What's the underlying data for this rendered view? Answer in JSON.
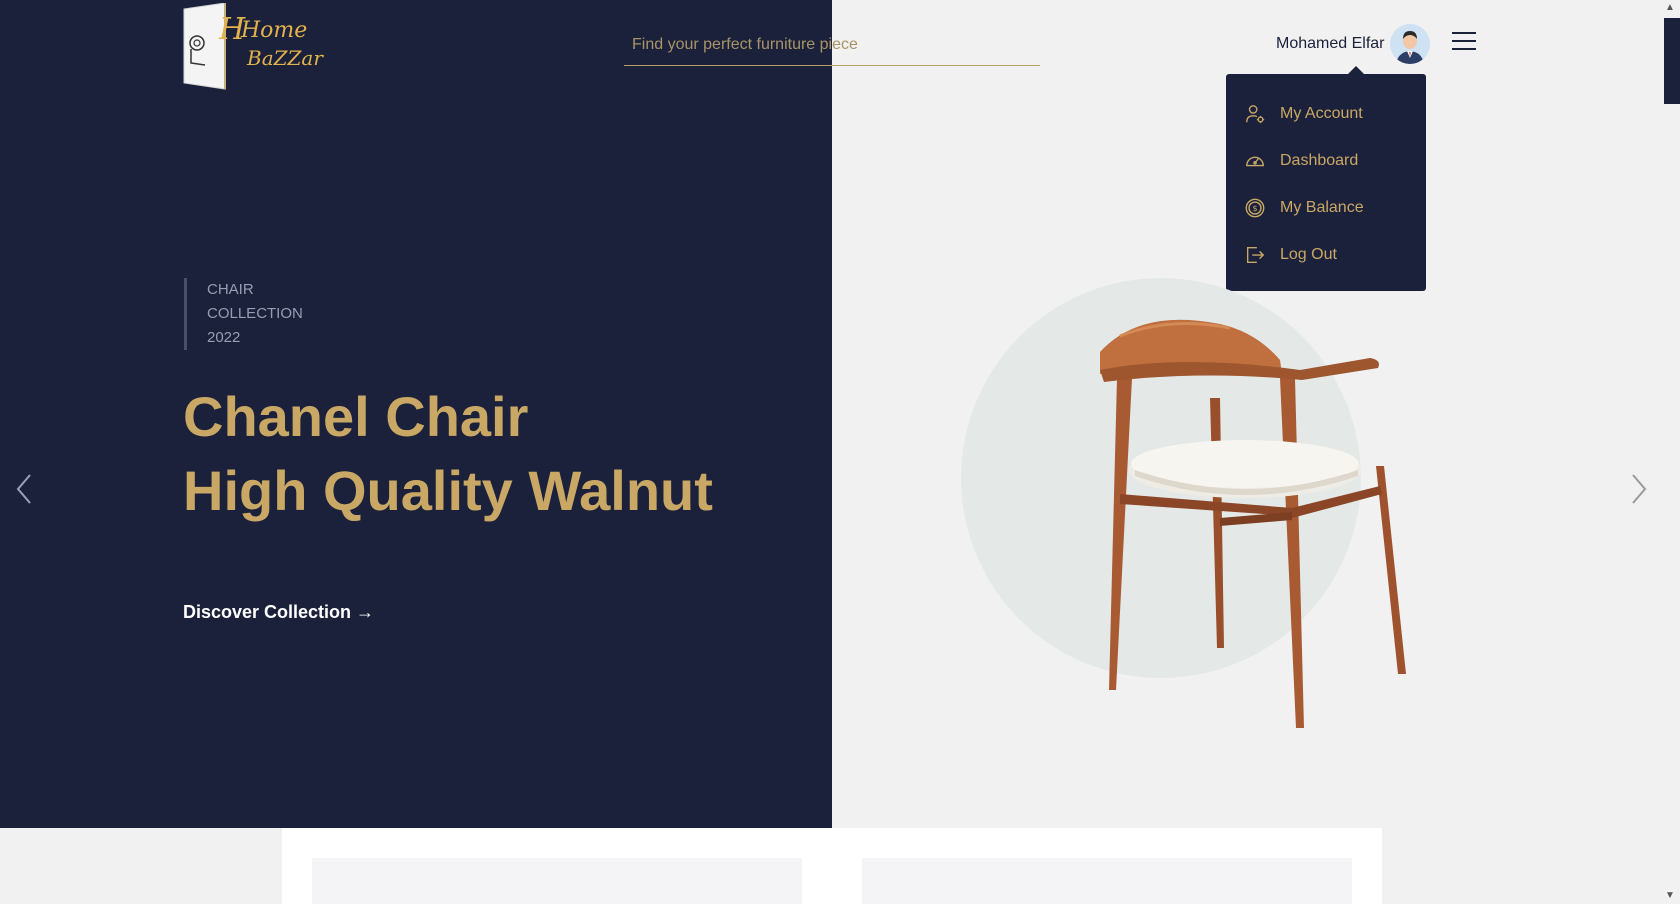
{
  "header": {
    "logo_text_top": "Home",
    "logo_text_bottom": "BaZZar",
    "search_placeholder": "Find your perfect furniture piece",
    "user_name": "Mohamed Elfar"
  },
  "user_menu": {
    "items": [
      {
        "label": "My Account",
        "icon": "user-settings-icon"
      },
      {
        "label": "Dashboard",
        "icon": "dashboard-gauge-icon"
      },
      {
        "label": "My Balance",
        "icon": "dollar-coin-icon"
      },
      {
        "label": "Log Out",
        "icon": "logout-icon"
      }
    ]
  },
  "hero": {
    "tag_line1": "CHAIR",
    "tag_line2": "COLLECTION",
    "tag_line3": "2022",
    "title_line1": "Chanel Chair",
    "title_line2": "High Quality Walnut",
    "cta": "Discover Collection →"
  },
  "colors": {
    "navy": "#1b213b",
    "gold": "#c9a865",
    "light_bg": "#f1f1f1"
  }
}
